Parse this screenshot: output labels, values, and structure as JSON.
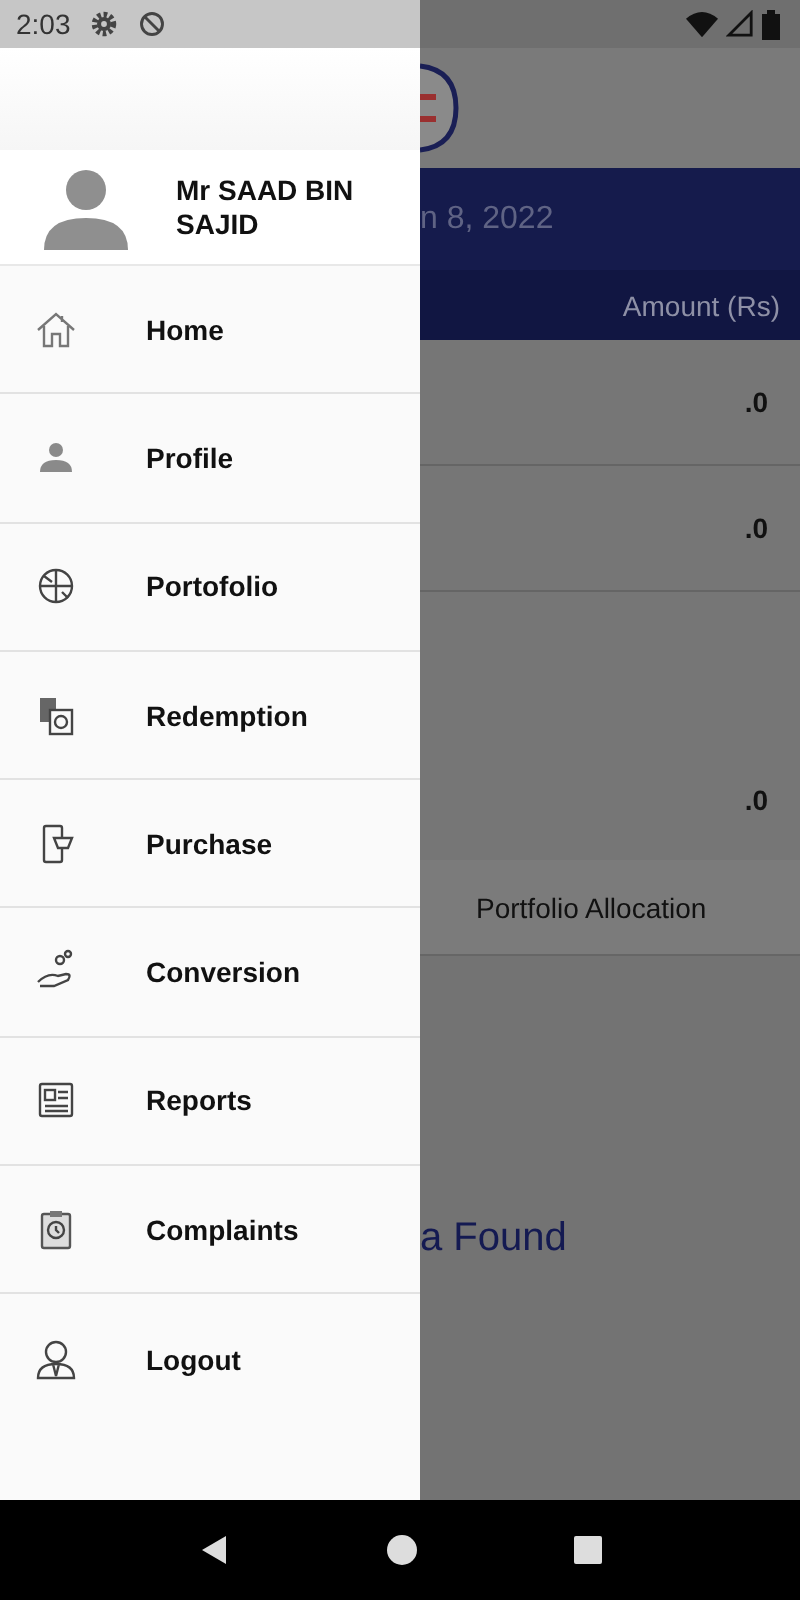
{
  "status_bar": {
    "time": "2:03"
  },
  "drawer": {
    "user_name": "Mr SAAD BIN SAJID",
    "items": [
      {
        "label": "Home"
      },
      {
        "label": "Profile"
      },
      {
        "label": "Portofolio"
      },
      {
        "label": "Redemption"
      },
      {
        "label": "Purchase"
      },
      {
        "label": "Conversion"
      },
      {
        "label": "Reports"
      },
      {
        "label": "Complaints"
      },
      {
        "label": "Logout"
      }
    ]
  },
  "background": {
    "date": "n 8, 2022",
    "column_header": "Amount (Rs)",
    "rows": [
      {
        "amount": ".0",
        "kind": "short"
      },
      {
        "amount": ".0",
        "kind": "short"
      },
      {
        "amount": ".0",
        "kind": "tall"
      }
    ],
    "tab": "Portfolio Allocation",
    "empty_message": "a Found"
  }
}
